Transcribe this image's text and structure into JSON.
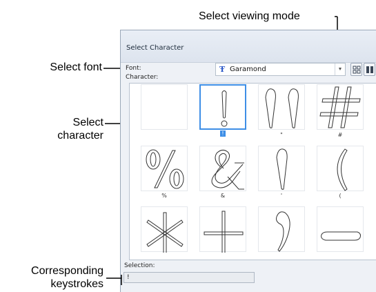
{
  "callouts": {
    "viewing_mode": "Select viewing mode",
    "font": "Select font",
    "character_line1": "Select",
    "character_line2": "character",
    "keystrokes_line1": "Corresponding",
    "keystrokes_line2": "keystrokes"
  },
  "dialog": {
    "title": "Select Character",
    "font_label": "Font:",
    "font_value": "Garamond",
    "character_label": "Character:",
    "selection_label": "Selection:",
    "selection_value": "!"
  },
  "icons": {
    "font_type": "truetype-font-icon",
    "dropdown": "chevron-down-icon",
    "view_large": "large-icons-view-icon",
    "view_small": "small-icons-view-icon",
    "view_list": "list-view-icon"
  },
  "characters": [
    {
      "glyph": "space",
      "caption": ""
    },
    {
      "glyph": "exclamation",
      "caption": "!"
    },
    {
      "glyph": "quotes",
      "caption": "\""
    },
    {
      "glyph": "hash",
      "caption": "#"
    },
    {
      "glyph": "percent",
      "caption": "%"
    },
    {
      "glyph": "ampersand",
      "caption": "&"
    },
    {
      "glyph": "apostrophe",
      "caption": "'"
    },
    {
      "glyph": "paren",
      "caption": "("
    },
    {
      "glyph": "asterisk",
      "caption": ""
    },
    {
      "glyph": "plus",
      "caption": ""
    },
    {
      "glyph": "comma",
      "caption": ""
    },
    {
      "glyph": "hyphen",
      "caption": ""
    }
  ],
  "selected_index": 1,
  "colors": {
    "selection_accent": "#3d8ee6",
    "dialog_background": "#eef1f6"
  }
}
